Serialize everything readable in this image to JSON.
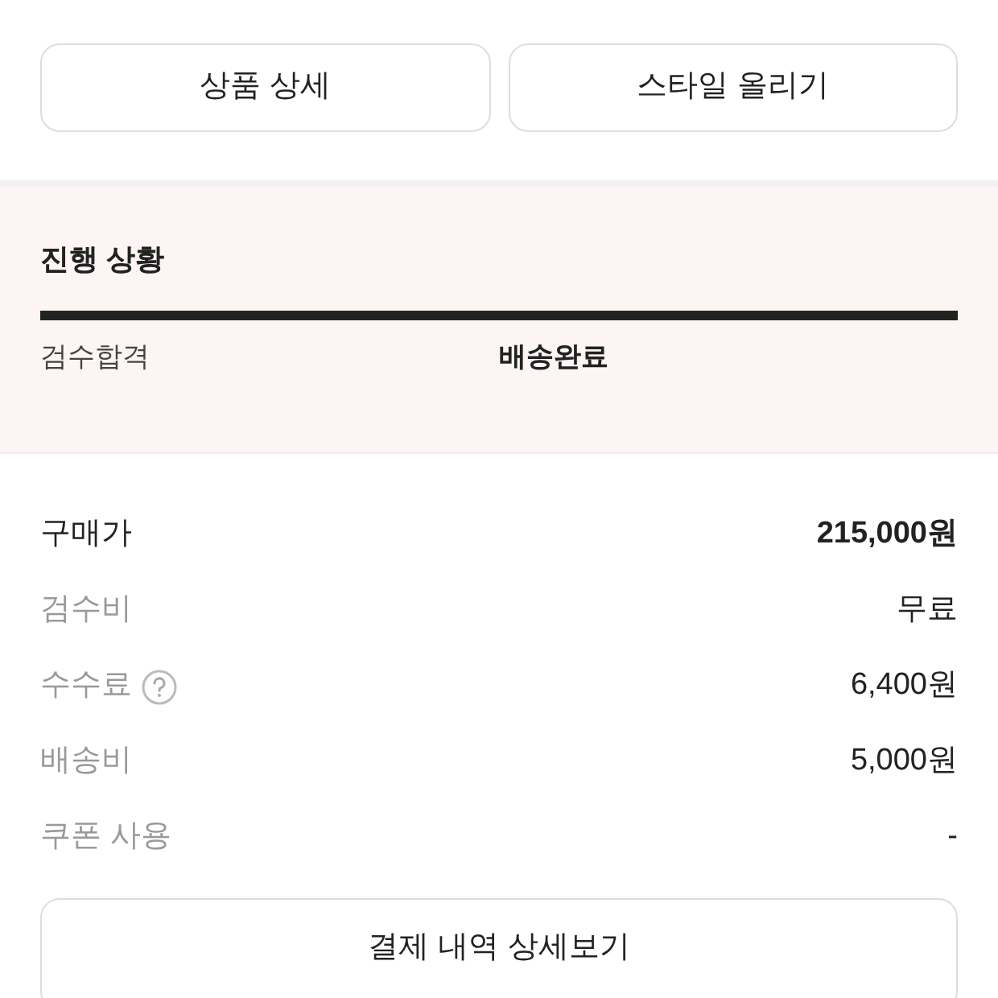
{
  "top_buttons": [
    "상품 상세",
    "스타일 올리기"
  ],
  "progress": {
    "title": "진행 상황",
    "level": 1,
    "steps": [
      {
        "label": "검수합격",
        "selected": false
      },
      {
        "label": "배송완료",
        "selected": true
      }
    ]
  },
  "price_rows": [
    {
      "kind": "total",
      "label": "구매가",
      "value": "215,000원",
      "help": false
    },
    {
      "kind": "item",
      "label": "검수비",
      "value": "무료",
      "help": false
    },
    {
      "kind": "item",
      "label": "수수료",
      "value": "6,400원",
      "help": true
    },
    {
      "kind": "item",
      "label": "배송비",
      "value": "5,000원",
      "help": false
    },
    {
      "kind": "item",
      "label": "쿠폰 사용",
      "value": "-",
      "help": false
    }
  ],
  "detail_button": "결제 내역 상세보기"
}
